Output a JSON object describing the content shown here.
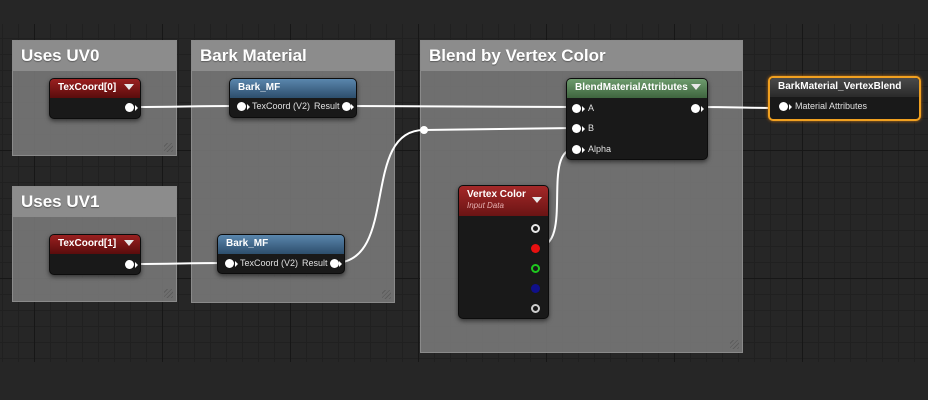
{
  "comments": {
    "uv0": "Uses UV0",
    "uv1": "Uses UV1",
    "bark": "Bark Material",
    "blend": "Blend by Vertex Color"
  },
  "nodes": {
    "texcoord0": {
      "title": "TexCoord[0]"
    },
    "texcoord1": {
      "title": "TexCoord[1]"
    },
    "bark_mf_top": {
      "title": "Bark_MF",
      "input": "TexCoord (V2)",
      "output": "Result"
    },
    "bark_mf_bottom": {
      "title": "Bark_MF",
      "input": "TexCoord (V2)",
      "output": "Result"
    },
    "blend": {
      "title": "BlendMaterialAttributes",
      "inputs": [
        "A",
        "B",
        "Alpha"
      ]
    },
    "vertex_color": {
      "title": "Vertex Color",
      "subtitle": "Input Data"
    },
    "result": {
      "title": "BarkMaterial_VertexBlend",
      "input": "Material Attributes"
    }
  },
  "colors": {
    "background": "#262626",
    "comment": "#808080",
    "wire": "#ffffff",
    "selection": "#f0a020",
    "vertex_red": "#e81010",
    "vertex_green": "#1ec81e",
    "vertex_blue": "#10108a"
  }
}
